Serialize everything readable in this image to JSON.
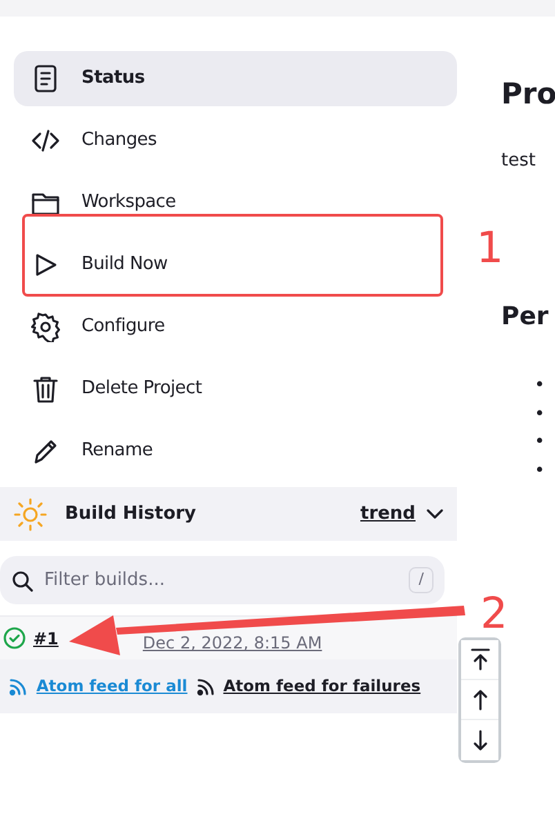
{
  "side_menu": [
    {
      "label": "Status",
      "kind": "document",
      "selected": true
    },
    {
      "label": "Changes",
      "kind": "code",
      "selected": false
    },
    {
      "label": "Workspace",
      "kind": "folder",
      "selected": false
    },
    {
      "label": "Build Now",
      "kind": "play",
      "selected": false
    },
    {
      "label": "Configure",
      "kind": "gear",
      "selected": false
    },
    {
      "label": "Delete Project",
      "kind": "trash",
      "selected": false
    },
    {
      "label": "Rename",
      "kind": "pencil",
      "selected": false
    }
  ],
  "build_history": {
    "title": "Build History",
    "trend": "trend",
    "filter": {
      "placeholder": "Filter builds...",
      "shortcut": "/"
    },
    "builds": [
      {
        "number": "#1",
        "date": "Dec 2, 2022, 8:15 AM",
        "kind": "success"
      }
    ],
    "feeds": [
      {
        "label": "Atom feed for all",
        "kind": "primary"
      },
      {
        "label": "Atom feed for failures",
        "kind": "plain"
      }
    ]
  },
  "content": {
    "title": "Pro",
    "description": "test",
    "section_title": "Per",
    "bullets": [
      "•",
      "•",
      "•",
      "•"
    ]
  },
  "scroll_buttons": [
    {
      "kind": "top"
    },
    {
      "kind": "up"
    },
    {
      "kind": "down"
    }
  ],
  "annotations": [
    {
      "kind": "box",
      "number": "1"
    },
    {
      "kind": "arrow",
      "number": "2"
    }
  ]
}
